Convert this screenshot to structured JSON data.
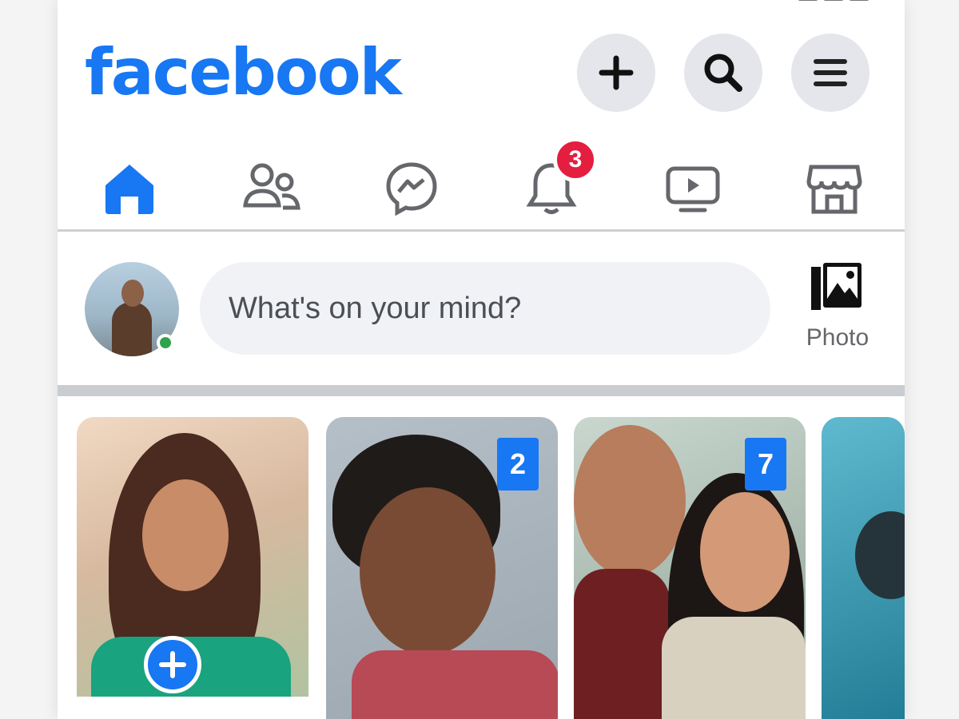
{
  "status_bar": {
    "time": ""
  },
  "header": {
    "logo": "facebook",
    "buttons": [
      "plus-icon",
      "search-icon",
      "menu-icon"
    ]
  },
  "nav": {
    "tabs": [
      "home",
      "friends",
      "messenger",
      "notifications",
      "watch",
      "marketplace"
    ],
    "active": "home",
    "notifications_badge": "3"
  },
  "composer": {
    "placeholder": "What's on your mind?",
    "photo_label": "Photo"
  },
  "stories": {
    "items": [
      {
        "count": ""
      },
      {
        "count": "2"
      },
      {
        "count": "7"
      }
    ]
  },
  "colors": {
    "brand": "#1877f2",
    "badge": "#e41e3f",
    "online": "#31a24c"
  }
}
